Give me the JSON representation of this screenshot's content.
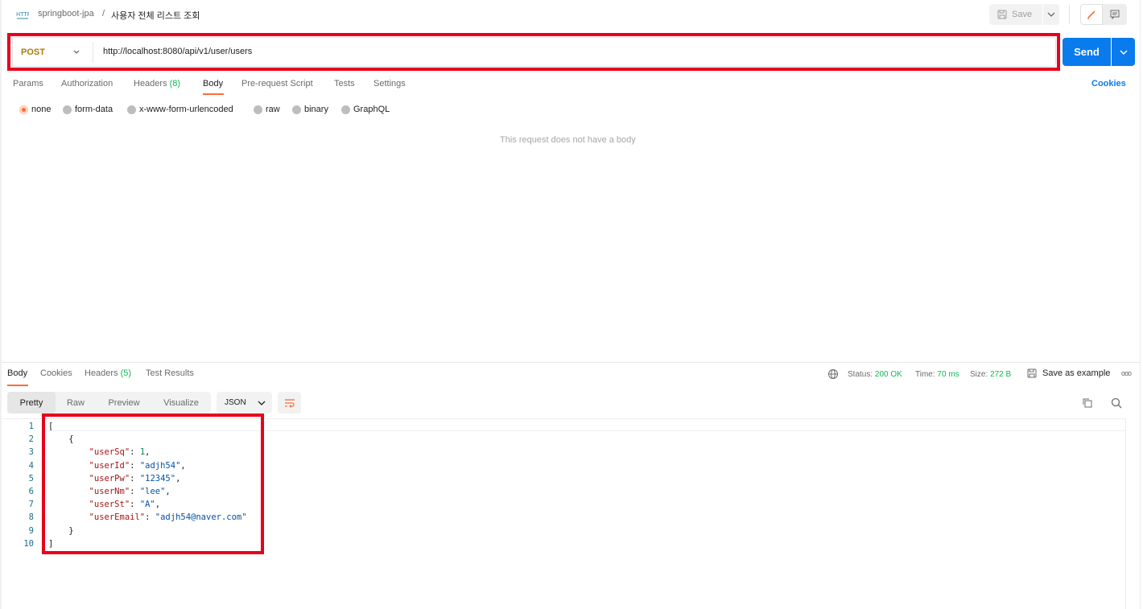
{
  "header": {
    "collection": "springboot-jpa",
    "separator": "/",
    "request_name": "사용자 전체 리스트 조회",
    "save_label": "Save"
  },
  "request": {
    "method": "POST",
    "url": "http://localhost:8080/api/v1/user/users",
    "send_label": "Send"
  },
  "request_tabs": {
    "params": "Params",
    "authorization": "Authorization",
    "headers": "Headers",
    "headers_count": "(8)",
    "body": "Body",
    "prerequest": "Pre-request Script",
    "tests": "Tests",
    "settings": "Settings",
    "cookies": "Cookies"
  },
  "body_types": {
    "none": "none",
    "form_data": "form-data",
    "urlencoded": "x-www-form-urlencoded",
    "raw": "raw",
    "binary": "binary",
    "graphql": "GraphQL",
    "selected": "none"
  },
  "empty_body_note": "This request does not have a body",
  "response": {
    "tabs": {
      "body": "Body",
      "cookies": "Cookies",
      "headers": "Headers",
      "headers_count": "(5)",
      "test_results": "Test Results"
    },
    "status_label": "Status:",
    "status_value": "200 OK",
    "time_label": "Time:",
    "time_value": "70 ms",
    "size_label": "Size:",
    "size_value": "272 B",
    "save_example": "Save as example",
    "more": "ooo",
    "views": {
      "pretty": "Pretty",
      "raw": "Raw",
      "preview": "Preview",
      "visualize": "Visualize"
    },
    "format": "JSON",
    "line_numbers": [
      "1",
      "2",
      "3",
      "4",
      "5",
      "6",
      "7",
      "8",
      "9",
      "10"
    ],
    "json": {
      "userSq_key": "\"userSq\"",
      "userSq_val": "1",
      "userId_key": "\"userId\"",
      "userId_val": "\"adjh54\"",
      "userPw_key": "\"userPw\"",
      "userPw_val": "\"12345\"",
      "userNm_key": "\"userNm\"",
      "userNm_val": "\"lee\"",
      "userSt_key": "\"userSt\"",
      "userSt_val": "\"A\"",
      "userEmail_key": "\"userEmail\"",
      "userEmail_val": "\"adjh54@naver.com\""
    }
  },
  "colors": {
    "accent": "#ff6c37",
    "send": "#097bed",
    "method_post": "#ad7a03",
    "highlight_frame": "#e8001c",
    "status_ok": "#0cbb52"
  }
}
